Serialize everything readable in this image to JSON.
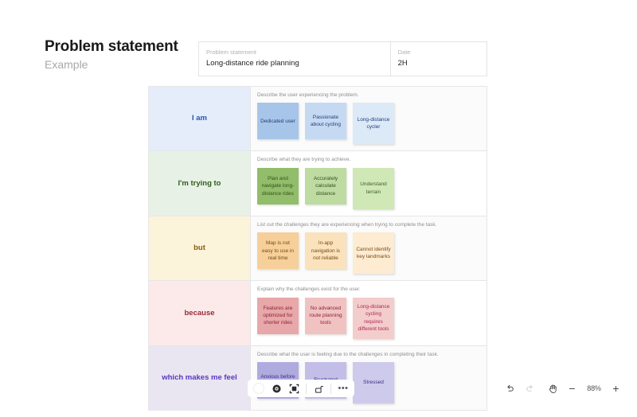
{
  "header": {
    "title": "Problem statement",
    "subtitle": "Example"
  },
  "meta_table": {
    "columns": [
      {
        "label": "Problem statement",
        "value": "Long-distance ride planning"
      },
      {
        "label": "Date",
        "value": "2H"
      }
    ]
  },
  "grid": {
    "rows": [
      {
        "label": "I am",
        "label_color": "#2a53b5",
        "label_bg": "#e4edf9",
        "hint": "Describe the user experiencing the problem.",
        "notes": [
          {
            "text": "Dedicated user",
            "bg": "#a7c5e8",
            "color": "#20407c",
            "tall": false
          },
          {
            "text": "Passionate about cycling",
            "bg": "#c5daf2",
            "color": "#20407c",
            "tall": false
          },
          {
            "text": "Long-distance cycler",
            "bg": "#dce9f7",
            "color": "#20407c",
            "tall": true
          }
        ]
      },
      {
        "label": "I'm trying to",
        "label_color": "#2f5d1f",
        "label_bg": "#e8f1e5",
        "hint": "Describe what they are trying to achieve.",
        "notes": [
          {
            "text": "Plan and navigate long-distance rides",
            "bg": "#92bd6a",
            "color": "#31511c",
            "tall": false
          },
          {
            "text": "Accurately calculate distance",
            "bg": "#bedba2",
            "color": "#31511c",
            "tall": false
          },
          {
            "text": "Understand terrain",
            "bg": "#cfe8b6",
            "color": "#3d5f26",
            "tall": true
          }
        ]
      },
      {
        "label": "but",
        "label_color": "#8a5a10",
        "label_bg": "#fbf4da",
        "hint": "List out the challenges they are experiencing when trying to complete the task.",
        "notes": [
          {
            "text": "Map is not easy to use in real time",
            "bg": "#f6cf9a",
            "color": "#7a4a12",
            "tall": false
          },
          {
            "text": "In-app navigation is not reliable",
            "bg": "#fae2bd",
            "color": "#7a4a12",
            "tall": false
          },
          {
            "text": "Cannot identify key landmarks",
            "bg": "#fdecd2",
            "color": "#7a4a12",
            "tall": true
          }
        ]
      },
      {
        "label": "because",
        "label_color": "#9b2b3c",
        "label_bg": "#fbeae9",
        "hint": "Explain why the challenges exist for the user.",
        "notes": [
          {
            "text": "Features are optimized for shorter rides",
            "bg": "#e8a7a9",
            "color": "#8c2237",
            "tall": false
          },
          {
            "text": "No advanced route planning tools",
            "bg": "#f0c3c2",
            "color": "#8c2237",
            "tall": false
          },
          {
            "text": "Long-distance cycling requires different tools",
            "bg": "#f2cdcb",
            "color": "#b4245a",
            "tall": true
          }
        ]
      },
      {
        "label": "which makes me feel",
        "label_color": "#5b35c4",
        "label_bg": "#e9e6f1",
        "hint": "Describe what the user is feeling due to the challenges in completing their task.",
        "notes": [
          {
            "text": "Anxious before long rides",
            "bg": "#b0abdf",
            "color": "#3b2d84",
            "tall": false
          },
          {
            "text": "Frustrated",
            "bg": "#c2bee8",
            "color": "#3b2d84",
            "tall": false
          },
          {
            "text": "Stressed",
            "bg": "#cdcaec",
            "color": "#3b2d84",
            "tall": true
          }
        ]
      }
    ]
  },
  "element_toolbar": {
    "items": [
      {
        "name": "color-swatch",
        "title": "Color"
      },
      {
        "name": "eye-icon",
        "title": "Visibility"
      },
      {
        "name": "frame-icon",
        "title": "Frame"
      },
      {
        "name": "unlock-icon",
        "title": "Lock"
      },
      {
        "name": "more-options-icon",
        "title": "More options",
        "glyph": "•••"
      }
    ]
  },
  "zoom_controls": {
    "undo_title": "Undo",
    "redo_title": "Redo",
    "hand_title": "Hand tool",
    "zoom_out_glyph": "−",
    "zoom_level": "88%",
    "zoom_in_glyph": "+"
  }
}
